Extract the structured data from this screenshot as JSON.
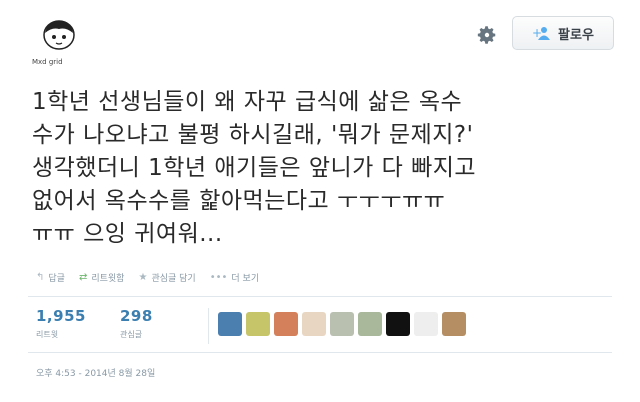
{
  "profile": {
    "avatar_caption": "Mxd grid"
  },
  "header": {
    "follow_label": "팔로우"
  },
  "tweet": {
    "text": "1학년 선생님들이 왜 자꾸 급식에 삶은 옥수\n수가 나오냐고 불평 하시길래, '뭐가 문제지?'\n생각했더니 1학년 애기들은 앞니가 다 빠지고\n없어서 옥수수를 핥아먹는다고 ㅜㅜㅜㅠㅠ\nㅠㅠ 으잉 귀여워..."
  },
  "actions": [
    {
      "icon": "reply-icon",
      "label": "답글"
    },
    {
      "icon": "retweet-icon",
      "label": "리트윗함"
    },
    {
      "icon": "star-icon",
      "label": "관심글 담기"
    },
    {
      "icon": "more-icon",
      "label": "더 보기"
    }
  ],
  "stats": {
    "retweets": {
      "count": "1,955",
      "label": "리트윗"
    },
    "favorites": {
      "count": "298",
      "label": "관심글"
    }
  },
  "favoriters": [
    {
      "color": "#4a7fb0"
    },
    {
      "color": "#c7c56a"
    },
    {
      "color": "#d4805a"
    },
    {
      "color": "#e8d6c2"
    },
    {
      "color": "#b9c0b0"
    },
    {
      "color": "#a9b79a"
    },
    {
      "color": "#111111"
    },
    {
      "color": "#eeeeee"
    },
    {
      "color": "#b58f63"
    }
  ],
  "timestamp": "오후 4:53 - 2014년 8월 28일"
}
